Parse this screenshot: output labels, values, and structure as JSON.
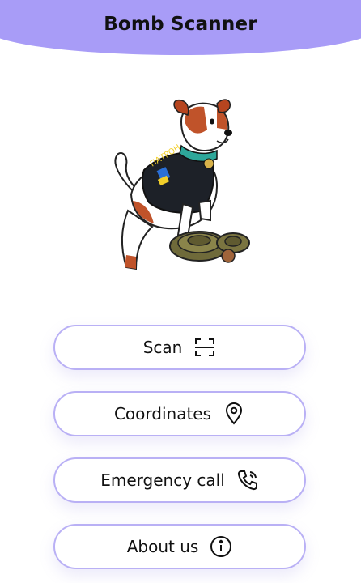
{
  "header": {
    "title": "Bomb Scanner",
    "color": "#a89cf7"
  },
  "illustration": {
    "vest_text": "ПАТРОН"
  },
  "buttons": [
    {
      "label": "Scan",
      "icon": "scan-icon"
    },
    {
      "label": "Coordinates",
      "icon": "location-pin-icon"
    },
    {
      "label": "Emergency call",
      "icon": "phone-call-icon"
    },
    {
      "label": "About us",
      "icon": "info-icon"
    }
  ],
  "accent_border": "#b9b0f5"
}
